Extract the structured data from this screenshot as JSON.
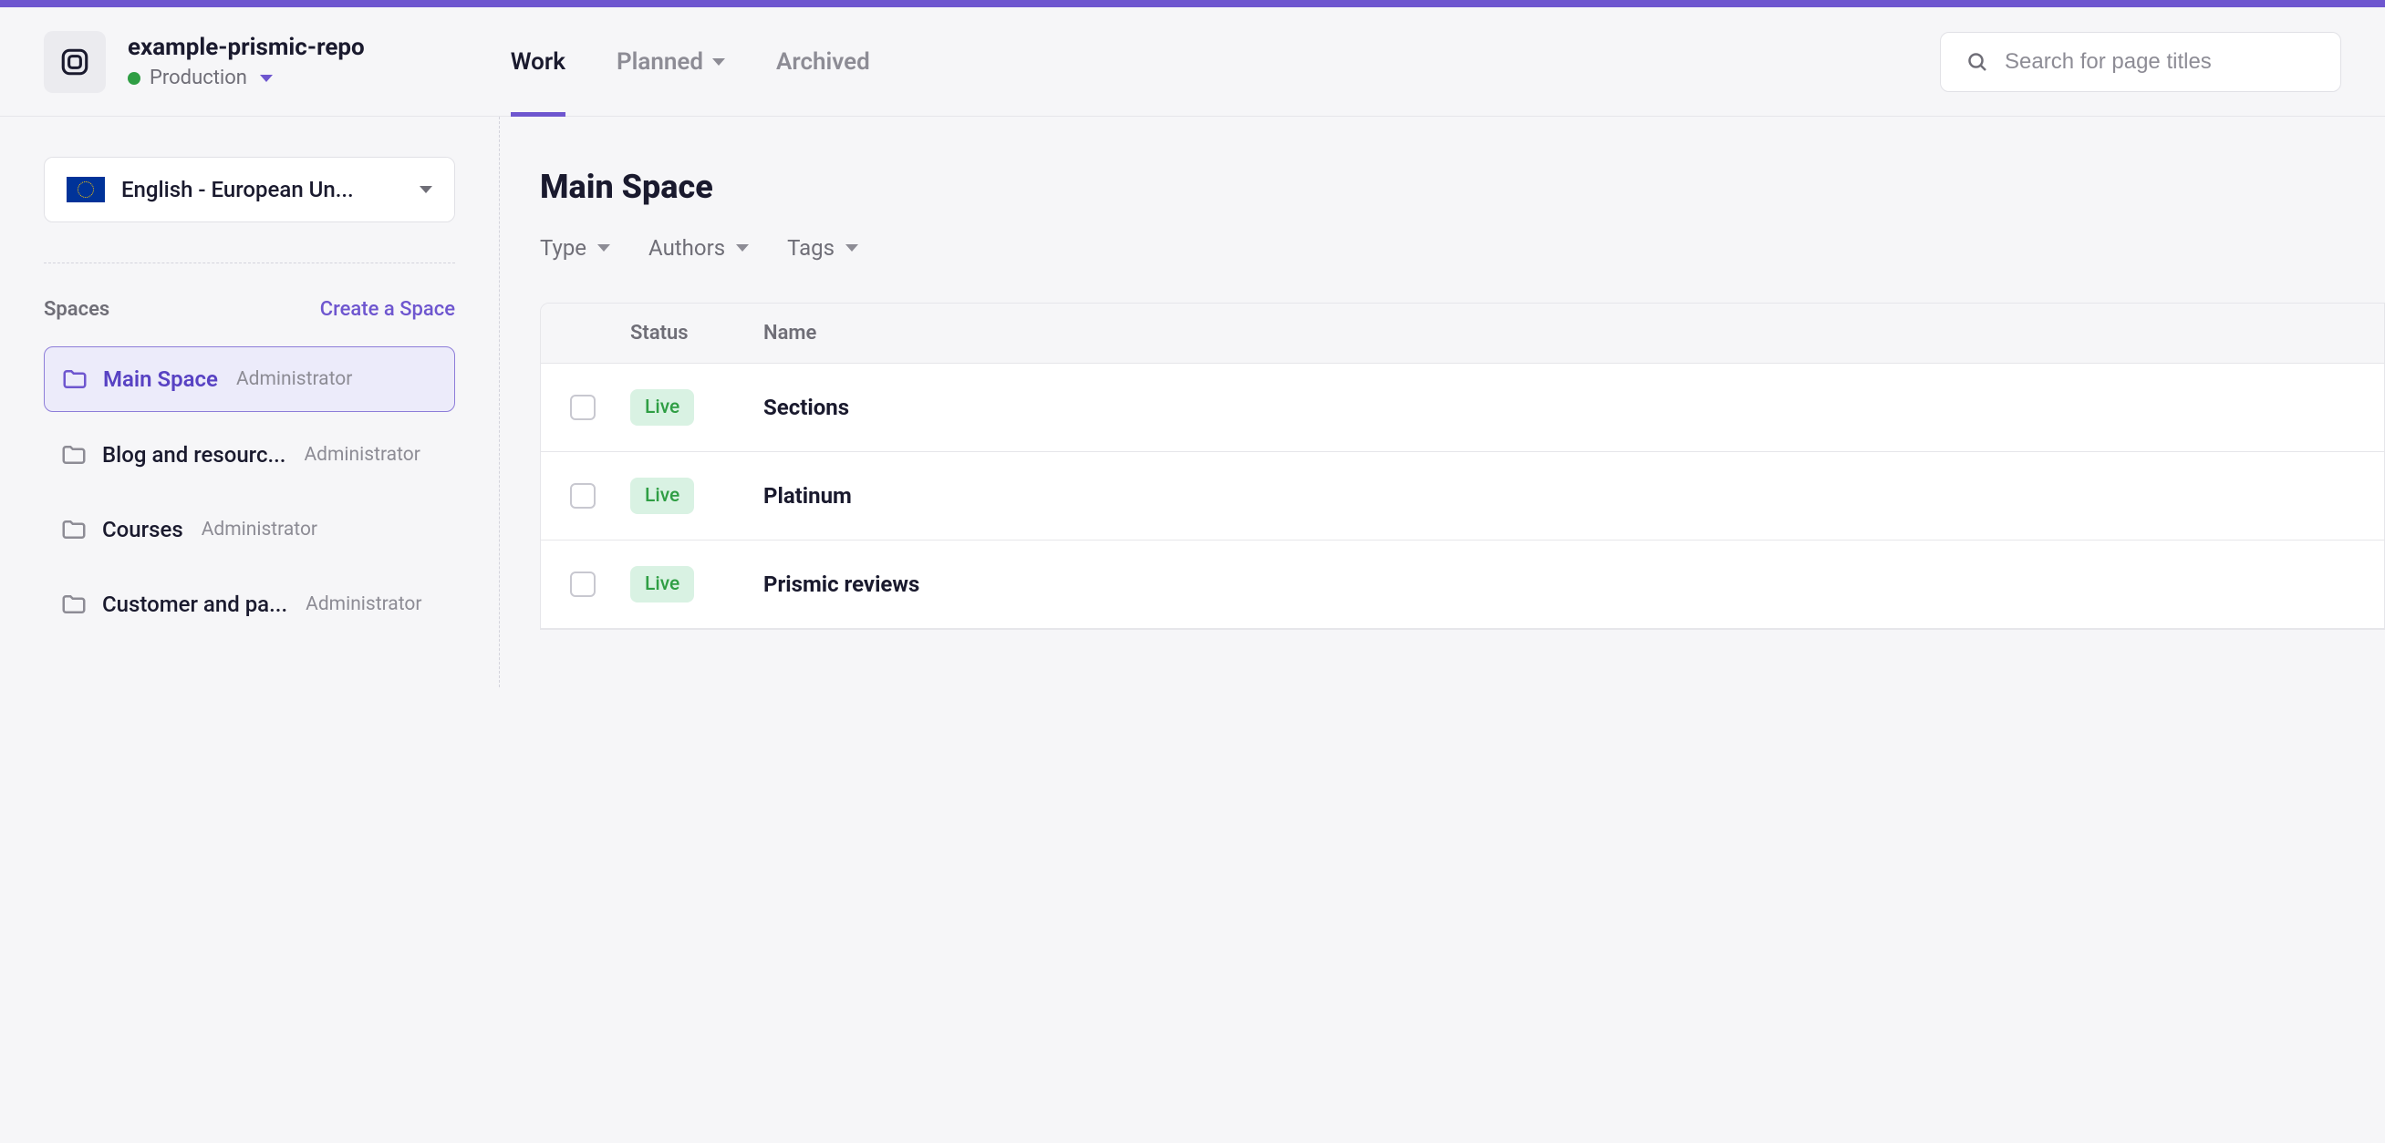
{
  "header": {
    "repo_name": "example-prismic-repo",
    "environment": "Production"
  },
  "nav": {
    "work": "Work",
    "planned": "Planned",
    "archived": "Archived"
  },
  "search": {
    "placeholder": "Search for page titles"
  },
  "sidebar": {
    "locale": "English - European Un...",
    "spaces_title": "Spaces",
    "create_space": "Create a Space",
    "spaces": [
      {
        "name": "Main Space",
        "role": "Administrator"
      },
      {
        "name": "Blog and resourc...",
        "role": "Administrator"
      },
      {
        "name": "Courses",
        "role": "Administrator"
      },
      {
        "name": "Customer and pa...",
        "role": "Administrator"
      }
    ]
  },
  "main": {
    "title": "Main Space",
    "filters": {
      "type": "Type",
      "authors": "Authors",
      "tags": "Tags"
    },
    "columns": {
      "status": "Status",
      "name": "Name"
    },
    "rows": [
      {
        "status": "Live",
        "name": "Sections"
      },
      {
        "status": "Live",
        "name": "Platinum"
      },
      {
        "status": "Live",
        "name": "Prismic reviews"
      }
    ]
  }
}
